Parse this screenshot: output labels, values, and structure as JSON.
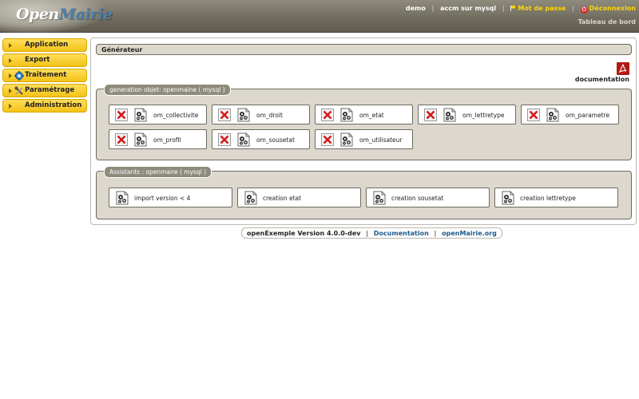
{
  "header": {
    "logo_open": "Open",
    "logo_mairie": "Mairie",
    "user": "demo",
    "collectivity": "accm sur mysql",
    "password_link": "Mot de passe",
    "logout_link": "Déconnexion",
    "dashboard_link": "Tableau de bord"
  },
  "menu": [
    {
      "label": "Application"
    },
    {
      "label": "Export"
    },
    {
      "label": "Traitement"
    },
    {
      "label": "Paramétrage"
    },
    {
      "label": "Administration"
    }
  ],
  "main": {
    "title": "Générateur",
    "doc_label": "documentation",
    "gen_legend": "generation objet: openmaine ( mysql )",
    "assistants_legend": "Assistants : openmaire ( mysql )",
    "objects": [
      "om_collectivite",
      "om_droit",
      "om_etat",
      "om_lettretype",
      "om_parametre",
      "om_profil",
      "om_sousetat",
      "om_utilisateur"
    ],
    "assistants": [
      "import version < 4",
      "creation etat",
      "creation sousetat",
      "creation lettretype"
    ]
  },
  "footer": {
    "version": "openExemple Version 4.0.0-dev",
    "doc_link": "Documentation",
    "site_link": "openMairie.org"
  },
  "colors": {
    "menu_yellow": "#f3c218",
    "header_bg": "#6e6a5d",
    "link_blue": "#1d5a8a",
    "panel_gray": "#dcd8cd"
  }
}
